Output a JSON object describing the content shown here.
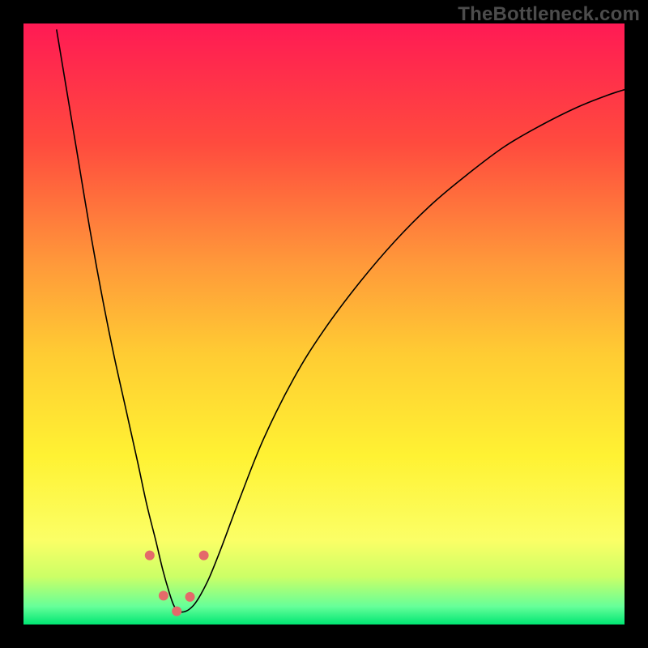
{
  "watermark": {
    "text": "TheBottleneck.com"
  },
  "chart_data": {
    "type": "line",
    "title": "",
    "xlabel": "",
    "ylabel": "",
    "xlim": [
      0,
      100
    ],
    "ylim": [
      0,
      100
    ],
    "grid": false,
    "legend": false,
    "background_gradient": {
      "stops": [
        {
          "offset": 0.0,
          "color": "#ff1a54"
        },
        {
          "offset": 0.2,
          "color": "#ff4b3e"
        },
        {
          "offset": 0.4,
          "color": "#ff993a"
        },
        {
          "offset": 0.55,
          "color": "#ffcc33"
        },
        {
          "offset": 0.72,
          "color": "#fff233"
        },
        {
          "offset": 0.86,
          "color": "#fbff66"
        },
        {
          "offset": 0.92,
          "color": "#ccff66"
        },
        {
          "offset": 0.97,
          "color": "#66ff99"
        },
        {
          "offset": 1.0,
          "color": "#00e673"
        }
      ]
    },
    "series": [
      {
        "name": "bottleneck-curve",
        "color": "#000000",
        "width": 1.6,
        "x": [
          5.5,
          7,
          9,
          11,
          13,
          15,
          17,
          19,
          20.5,
          22,
          23.2,
          24.2,
          25,
          25.8,
          27,
          28.3,
          29.5,
          31,
          33,
          36,
          40,
          45,
          50,
          56,
          62,
          68,
          74,
          80,
          86,
          92,
          97,
          100
        ],
        "y": [
          99,
          90,
          78,
          66,
          55,
          45,
          36,
          27,
          20,
          14,
          9,
          5.5,
          3.2,
          2.2,
          2.2,
          3.2,
          5,
          8,
          13,
          21,
          31,
          41,
          49,
          57,
          64,
          70,
          75,
          79.5,
          83,
          86,
          88,
          89
        ]
      }
    ],
    "markers": {
      "color": "#e46a6a",
      "radius": 6.0,
      "points": [
        {
          "x": 21.0,
          "y": 11.5
        },
        {
          "x": 23.3,
          "y": 4.8
        },
        {
          "x": 25.5,
          "y": 2.2
        },
        {
          "x": 27.7,
          "y": 4.6
        },
        {
          "x": 30.0,
          "y": 11.5
        }
      ]
    }
  }
}
